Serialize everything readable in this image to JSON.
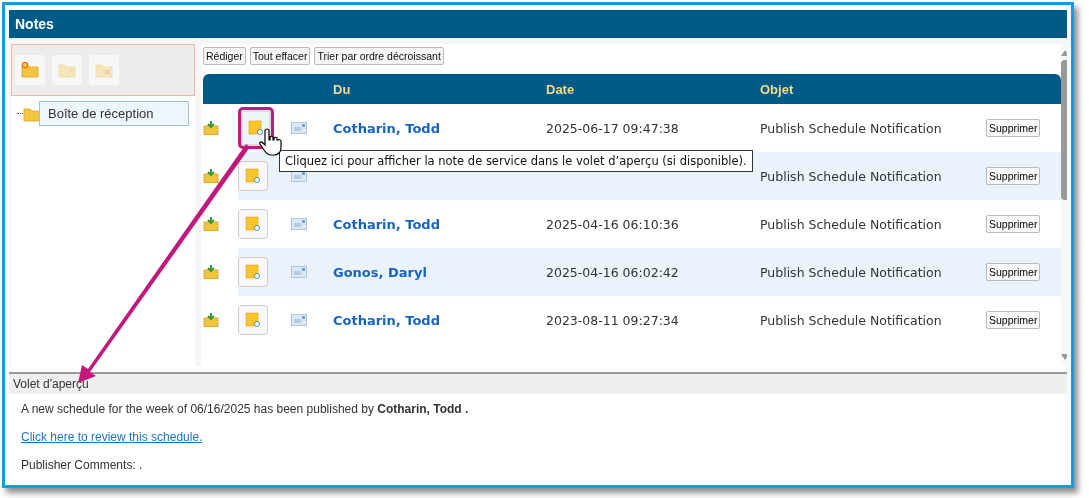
{
  "window": {
    "title": "Notes"
  },
  "folder_toolbar": [
    {
      "kind": "new",
      "disabled": false
    },
    {
      "kind": "move",
      "disabled": true
    },
    {
      "kind": "delete",
      "disabled": true
    }
  ],
  "tree": [
    {
      "label": "Boîte de réception",
      "selected": true
    }
  ],
  "actions": [
    "Rédiger",
    "Tout effacer",
    "Trier par ordre décroissant"
  ],
  "table": {
    "columns": [
      "Du",
      "Date",
      "Objet"
    ],
    "rows": [
      {
        "from": "Cotharin, Todd",
        "date": "2025-06-17 09:47:38",
        "subject": "Publish Schedule Notification",
        "action": "Supprimer",
        "highlighted": true
      },
      {
        "subject": "Publish Schedule Notification",
        "action": "Supprimer",
        "highlighted": false
      },
      {
        "from": "Cotharin, Todd",
        "date": "2025-04-16 06:10:36",
        "subject": "Publish Schedule Notification",
        "action": "Supprimer",
        "highlighted": false
      },
      {
        "from": "Gonos, Daryl",
        "date": "2025-04-16 06:02:42",
        "subject": "Publish Schedule Notification",
        "action": "Supprimer",
        "highlighted": false
      },
      {
        "from": "Cotharin, Todd",
        "date": "2023-08-11 09:27:34",
        "subject": "Publish Schedule Notification",
        "action": "Supprimer",
        "highlighted": false
      }
    ]
  },
  "tooltip": "Cliquez ici pour afficher la note de service dans le volet d’aperçu (si disponible).",
  "preview": {
    "title": "Volet d'aperçu",
    "message": "A new schedule for the week of 06/16/2025 has been published by **Cotharin, Todd .**",
    "link": "Click here to review this schedule.",
    "comments": "Publisher Comments: ."
  }
}
